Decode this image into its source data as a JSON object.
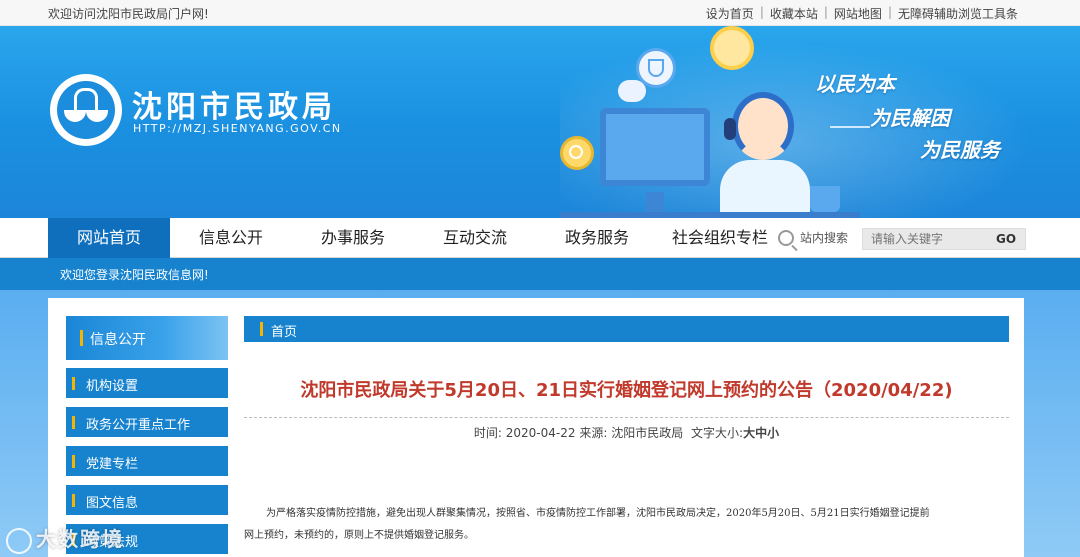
{
  "topbar": {
    "welcome": "欢迎访问沈阳市民政局门户网!",
    "links": [
      "设为首页",
      "收藏本站",
      "网站地图",
      "无障碍辅助浏览工具条"
    ]
  },
  "banner": {
    "site_name": "沈阳市民政局",
    "site_url": "HTTP://MZJ.SHENYANG.GOV.CN",
    "slogans": [
      "以民为本",
      "为民解困",
      "为民服务"
    ]
  },
  "nav": {
    "items": [
      "网站首页",
      "信息公开",
      "办事服务",
      "互动交流",
      "政务服务",
      "社会组织专栏"
    ],
    "active_index": 0,
    "search_label": "站内搜索",
    "search_placeholder": "请输入关键字",
    "search_button": "GO"
  },
  "strip": {
    "welcome": "欢迎您登录沈阳民政信息网!"
  },
  "sidebar": {
    "header": "信息公开",
    "items": [
      "机构设置",
      "政务公开重点工作",
      "党建专栏",
      "图文信息",
      "政策法规"
    ]
  },
  "article": {
    "breadcrumb": "首页",
    "title": "沈阳市民政局关于5月20日、21日实行婚姻登记网上预约的公告（2020/04/22)",
    "meta_time_label": "时间:",
    "meta_time": "2020-04-22",
    "meta_source_label": "来源:",
    "meta_source": "沈阳市民政局",
    "meta_size_label": "文字大小:",
    "meta_sizes": [
      "大",
      "中",
      "小"
    ],
    "para_line1": "为严格落实疫情防控措施，避免出现人群聚集情况，按照省、市疫情防控工作部署，沈阳市民政局决定，2020年5月20日、5月21日实行婚姻登记提前",
    "para_line2": "网上预约，未预约的，原则上不提供婚姻登记服务。"
  },
  "watermark": {
    "text": "大数跨境"
  },
  "colors": {
    "primary": "#1783cf",
    "nav_active": "#0f6fbd",
    "title_red": "#c0392b",
    "accent_bar": "#f5b400"
  }
}
